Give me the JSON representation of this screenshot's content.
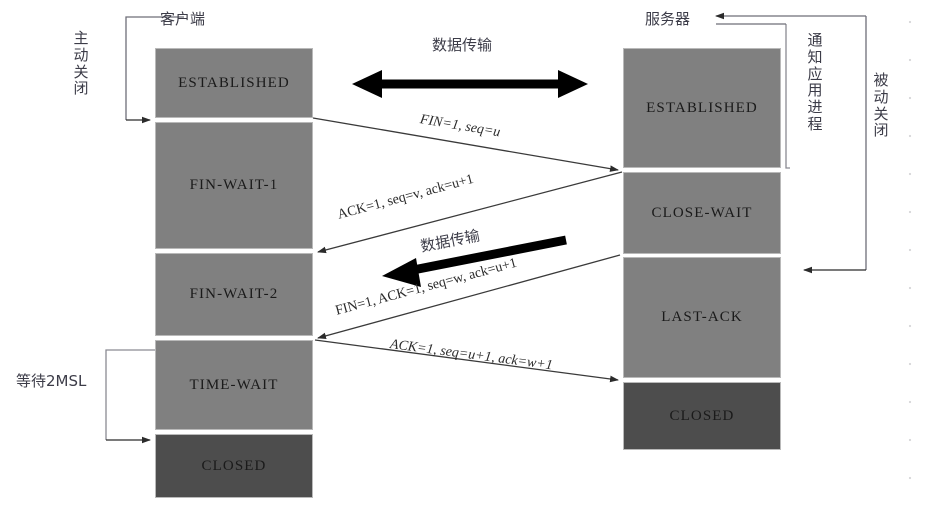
{
  "diagram": {
    "title_client": "客户端",
    "title_server": "服务器",
    "client_side_label": [
      "主",
      "动",
      "关",
      "闭"
    ],
    "server_notify_label": [
      "通",
      "知",
      "应",
      "用",
      "进",
      "程"
    ],
    "server_side_label": [
      "被",
      "动",
      "关",
      "闭"
    ],
    "wait_label": "等待2MSL",
    "data_transfer_top": "数据传输",
    "data_transfer_mid": "数据传输",
    "colors": {
      "state_fill": "#808080",
      "closed_fill": "#4d4d4d",
      "box_border": "#b9b9b9",
      "line": "#4a4a4a",
      "text_cjk": "#3c3c48",
      "background": "#ffffff"
    },
    "client_states": [
      {
        "label": "ESTABLISHED",
        "closed": false
      },
      {
        "label": "FIN-WAIT-1",
        "closed": false
      },
      {
        "label": "FIN-WAIT-2",
        "closed": false
      },
      {
        "label": "TIME-WAIT",
        "closed": false
      },
      {
        "label": "CLOSED",
        "closed": true
      }
    ],
    "server_states": [
      {
        "label": "ESTABLISHED",
        "closed": false
      },
      {
        "label": "CLOSE-WAIT",
        "closed": false
      },
      {
        "label": "LAST-ACK",
        "closed": false
      },
      {
        "label": "CLOSED",
        "closed": true
      }
    ],
    "segments": [
      {
        "text": "FIN=1,  seq=u",
        "direction": "client-to-server"
      },
      {
        "text": "ACK=1, seq=v, ack=u+1",
        "direction": "server-to-client"
      },
      {
        "text": "FIN=1,  ACK=1,  seq=w, ack=u+1",
        "direction": "server-to-client"
      },
      {
        "text": "ACK=1, seq=u+1, ack=w+1",
        "direction": "client-to-server"
      }
    ]
  }
}
